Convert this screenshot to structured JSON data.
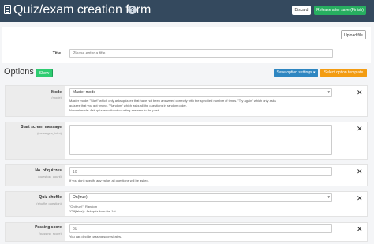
{
  "header": {
    "title": "Quiz/exam creation form",
    "help_glyph": "?",
    "discard_label": "Discard",
    "release_label": "Release after save (Finish)"
  },
  "title_field": {
    "upload_label": "Upload file",
    "label": "Title",
    "placeholder": "Please enter a title"
  },
  "options": {
    "heading": "Options",
    "show_label": "Show",
    "save_settings_label": "Save option settings ▾",
    "select_template_label": "Select option template"
  },
  "mode": {
    "label": "Mode",
    "key": "(mode)",
    "value": "Master mode",
    "desc_lines": [
      "Master mode: \"Start\" which only asks quizzes that have not been answered correctly with the specified number of times. \"Try again\" which only asks",
      "quizzes that you got wrong. \"Random\" which asks all the questions in random order.",
      "Normal mode: Ask quizzes without counting answers in the past."
    ]
  },
  "start_message": {
    "label": "Start screen message",
    "key": "(messages_intro)"
  },
  "num_quizzes": {
    "label": "No. of quizzes",
    "key": "(question_count)",
    "placeholder": "10",
    "desc": "If you don't specify any value, all questions will be asked."
  },
  "shuffle": {
    "label": "Quiz shuffle",
    "key": "(shuffle_question)",
    "value": "On(true)",
    "desc_lines": [
      "\"On(true)\": Random",
      "\"Off(false)\": Ask quiz from the 1st"
    ]
  },
  "passing": {
    "label": "Passing score",
    "key": "(passing_score)",
    "placeholder": "80",
    "desc": "You can decide passing scores/rates."
  },
  "icons": [
    "document-icon",
    "help-icon",
    "close-icon",
    "caret-down-icon"
  ],
  "colors": {
    "header_bg": "#34495e",
    "release_green": "#27ae60",
    "show_green": "#2ecc71",
    "save_blue": "#2e86c1",
    "template_orange": "#f39c12"
  }
}
